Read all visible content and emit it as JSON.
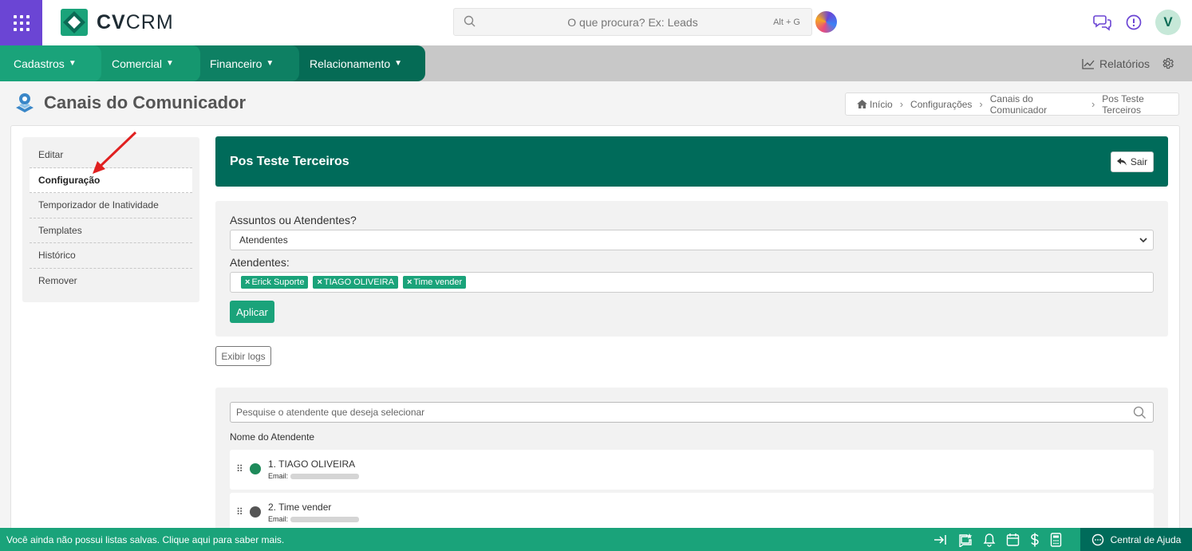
{
  "header": {
    "brand_bold": "CV",
    "brand_light": "CRM",
    "search_placeholder": "O que procura? Ex: Leads",
    "search_shortcut": "Alt + G",
    "avatar_initial": "V"
  },
  "nav": {
    "tabs": [
      {
        "label": "Cadastros",
        "color": "#1aa37a"
      },
      {
        "label": "Comercial",
        "color": "#15976f"
      },
      {
        "label": "Financeiro",
        "color": "#0e8063"
      },
      {
        "label": "Relacionamento",
        "color": "#056b55"
      }
    ],
    "reports_label": "Relatórios"
  },
  "page": {
    "title": "Canais do Comunicador",
    "breadcrumb": [
      "Início",
      "Configurações",
      "Canais do Comunicador",
      "Pos Teste Terceiros"
    ]
  },
  "side_menu": {
    "items": [
      "Editar",
      "Configuração",
      "Temporizador de Inatividade",
      "Templates",
      "Histórico",
      "Remover"
    ],
    "active_index": 1
  },
  "channel": {
    "name": "Pos Teste Terceiros",
    "exit_label": "Sair"
  },
  "config": {
    "question_label": "Assuntos ou Atendentes?",
    "selected_option": "Atendentes",
    "attendants_label": "Atendentes:",
    "tags": [
      "Erick Suporte",
      "TIAGO OLIVEIRA",
      "Time vender"
    ],
    "apply_label": "Aplicar",
    "logs_label": "Exibir logs"
  },
  "agents": {
    "search_placeholder": "Pesquise o atendente que deseja selecionar",
    "column_header": "Nome do Atendente",
    "email_label": "Email:",
    "rows": [
      {
        "name": "1. TIAGO OLIVEIRA",
        "status_color": "#1e8a5a"
      },
      {
        "name": "2. Time vender",
        "status_color": "#555555"
      }
    ]
  },
  "footer": {
    "message": "Você ainda não possui listas salvas. Clique aqui para saber mais.",
    "help_label": "Central de Ajuda"
  },
  "colors": {
    "accent_green": "#1aa37a",
    "dark_green": "#006b5a",
    "apps_purple": "#6b45d4"
  }
}
